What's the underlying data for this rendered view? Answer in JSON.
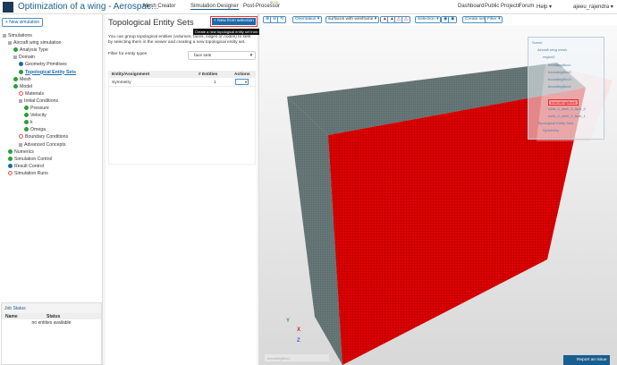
{
  "header": {
    "title": "Optimization of a wing - Aerospac...",
    "nav": [
      "Mesh Creator",
      "Simulation Designer",
      "Post-Processor"
    ],
    "beta": "BETA",
    "links": [
      "Dashboard",
      "Public Projects",
      "Forum",
      "Help ▾"
    ],
    "user": "ajeeu_rajendra ▾"
  },
  "left": {
    "new_sim": "+ New simulation",
    "tree": [
      {
        "label": "Simulations",
        "icon": "plus",
        "lvl": 0
      },
      {
        "label": "Aircraft wing simulation",
        "icon": "plus",
        "lvl": 1
      },
      {
        "label": "Analysis Type",
        "icon": "g",
        "lvl": 2
      },
      {
        "label": "Domain",
        "icon": "plus",
        "lvl": 2
      },
      {
        "label": "Geometry Primitives",
        "icon": "b",
        "lvl": 3
      },
      {
        "label": "Topological Entity Sets",
        "icon": "g",
        "lvl": 3
      },
      {
        "label": "Mesh",
        "icon": "g",
        "lvl": 2
      },
      {
        "label": "Model",
        "icon": "g",
        "lvl": 2
      },
      {
        "label": "Materials",
        "icon": "o",
        "lvl": 3
      },
      {
        "label": "Initial Conditions",
        "icon": "plus",
        "lvl": 3
      },
      {
        "label": "Pressure",
        "icon": "g",
        "lvl": 4
      },
      {
        "label": "Velocity",
        "icon": "g",
        "lvl": 4
      },
      {
        "label": "k",
        "icon": "g",
        "lvl": 4
      },
      {
        "label": "Omega",
        "icon": "g",
        "lvl": 4
      },
      {
        "label": "Boundary Conditions",
        "icon": "o",
        "lvl": 3
      },
      {
        "label": "Advanced Concepts",
        "icon": "plus",
        "lvl": 3
      },
      {
        "label": "Numerics",
        "icon": "g",
        "lvl": 1
      },
      {
        "label": "Simulation Control",
        "icon": "g",
        "lvl": 1
      },
      {
        "label": "Result Control",
        "icon": "b",
        "lvl": 1
      },
      {
        "label": "Simulation Runs",
        "icon": "o",
        "lvl": 1
      }
    ],
    "job": {
      "title": "Job Status",
      "cols": [
        "Name",
        "Status"
      ],
      "empty": "no entities available"
    }
  },
  "panel": {
    "title": "Topological Entity Sets",
    "new_btn": "+ New from selection",
    "tooltip": "Create a new topological entity set from selection",
    "desc": "You can group topological entities (volumes, faces, edges or nodes) to sets by selecting them in the viewer and creating a new topological entity set.",
    "filter_label": "Filter for entity types",
    "filter_value": "face sets",
    "cols": [
      "Entity/Assignment",
      "# Entities",
      "Actions"
    ],
    "rows": [
      {
        "name": "Symmetry",
        "count": "1"
      }
    ]
  },
  "toolbar": {
    "orientation": "Orientation ▾",
    "render": "surfaces with wireframe ▾",
    "selection": "Selection ▾",
    "create": "Create set",
    "filter": "Filter ▾"
  },
  "scene": {
    "items": [
      "Scene",
      "Aircraft wing mesh",
      "region0",
      "boundingBox1",
      "boundingBox2",
      "boundingBox3",
      "boundingBox4",
      "boundingBox5",
      "boundingBox6",
      "solid_0_shell_0_face_0",
      "solid_0_shell_0_face_1",
      "Topological Entity Sets",
      "Symmetry"
    ],
    "selected": "boundingBox6"
  },
  "viewer": {
    "status": "boundingBox1",
    "report": "Report an issue",
    "axes": [
      "Y",
      "X",
      "Z"
    ]
  },
  "colors": {
    "accent": "#1a5d8f",
    "selected_face": "#e00000",
    "mesh": "#5a6a6a"
  }
}
